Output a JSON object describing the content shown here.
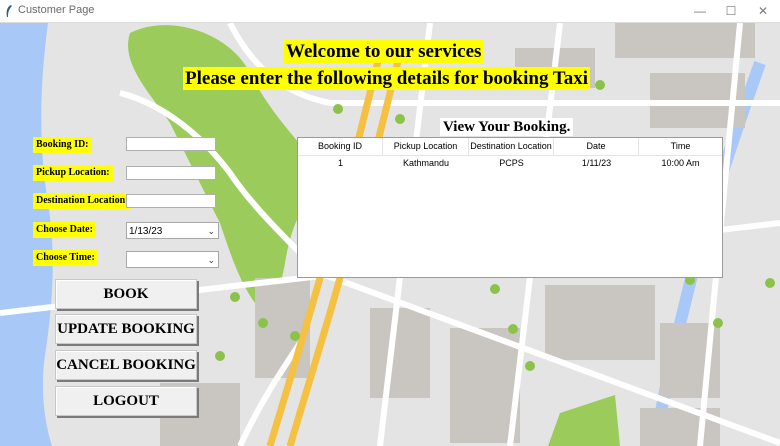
{
  "window": {
    "title": "Customer Page",
    "minimize": "—",
    "maximize": "☐",
    "close": "✕"
  },
  "header": {
    "welcome": "Welcome to our services",
    "instruction": "Please enter the following details for booking Taxi"
  },
  "form": {
    "booking_id_label": "Booking ID:",
    "pickup_label": "Pickup Location:",
    "destination_label": "Destination Location:",
    "date_label": "Choose Date:",
    "date_value": "1/13/23",
    "time_label": "Choose Time:",
    "time_value": ""
  },
  "buttons": {
    "book": "BOOK",
    "update": "UPDATE BOOKING",
    "cancel": "CANCEL BOOKING",
    "logout": "LOGOUT"
  },
  "bookings": {
    "title": "View Your Booking.",
    "columns": [
      "Booking ID",
      "Pickup Location",
      "Destination Location",
      "Date",
      "Time"
    ],
    "rows": [
      [
        "1",
        "Kathmandu",
        "PCPS",
        "1/11/23",
        "10:00 Am"
      ]
    ]
  },
  "colors": {
    "highlight": "#ffff00",
    "water": "#a8c8f8",
    "park": "#9bcb5b",
    "road": "#f5c142"
  }
}
